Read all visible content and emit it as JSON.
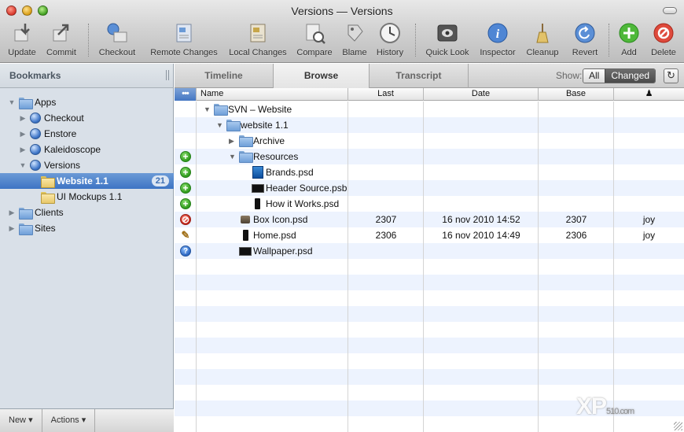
{
  "window": {
    "title": "Versions — Versions"
  },
  "toolbar": {
    "items": [
      {
        "label": "Update",
        "icon": "update-icon"
      },
      {
        "label": "Commit",
        "icon": "commit-icon"
      },
      {
        "label": "Checkout",
        "icon": "checkout-icon"
      },
      {
        "label": "Remote Changes",
        "icon": "remote-changes-icon"
      },
      {
        "label": "Local Changes",
        "icon": "local-changes-icon"
      },
      {
        "label": "Compare",
        "icon": "compare-icon"
      },
      {
        "label": "Blame",
        "icon": "blame-icon"
      },
      {
        "label": "History",
        "icon": "history-icon"
      },
      {
        "label": "Quick Look",
        "icon": "quick-look-icon"
      },
      {
        "label": "Inspector",
        "icon": "inspector-icon"
      },
      {
        "label": "Cleanup",
        "icon": "cleanup-icon"
      },
      {
        "label": "Revert",
        "icon": "revert-icon"
      },
      {
        "label": "Add",
        "icon": "add-icon"
      },
      {
        "label": "Delete",
        "icon": "delete-icon"
      }
    ]
  },
  "sidebar": {
    "title": "Bookmarks",
    "items": [
      {
        "label": "Apps"
      },
      {
        "label": "Checkout"
      },
      {
        "label": "Enstore"
      },
      {
        "label": "Kaleidoscope"
      },
      {
        "label": "Versions"
      },
      {
        "label": "Website 1.1",
        "badge": "21"
      },
      {
        "label": "UI Mockups 1.1"
      },
      {
        "label": "Clients"
      },
      {
        "label": "Sites"
      }
    ],
    "footer": {
      "new_label": "New",
      "actions_label": "Actions"
    }
  },
  "tabs": [
    {
      "label": "Timeline"
    },
    {
      "label": "Browse"
    },
    {
      "label": "Transcript"
    }
  ],
  "filter": {
    "label": "Show:",
    "all": "All",
    "changed": "Changed"
  },
  "table": {
    "columns": {
      "status": "•••",
      "name": "Name",
      "last": "Last",
      "date": "Date",
      "base": "Base",
      "author_icon": "person-icon"
    },
    "rows": [
      {
        "status": "",
        "name": "SVN – Website",
        "last": "",
        "date": "",
        "base": "",
        "author": ""
      },
      {
        "status": "",
        "name": "website 1.1",
        "last": "",
        "date": "",
        "base": "",
        "author": ""
      },
      {
        "status": "",
        "name": "Archive",
        "last": "",
        "date": "",
        "base": "",
        "author": ""
      },
      {
        "status": "added",
        "name": "Resources",
        "last": "",
        "date": "",
        "base": "",
        "author": ""
      },
      {
        "status": "added",
        "name": "Brands.psd",
        "last": "",
        "date": "",
        "base": "",
        "author": ""
      },
      {
        "status": "added",
        "name": "Header Source.psb",
        "last": "",
        "date": "",
        "base": "",
        "author": ""
      },
      {
        "status": "added",
        "name": "How it Works.psd",
        "last": "",
        "date": "",
        "base": "",
        "author": ""
      },
      {
        "status": "deleted",
        "name": "Box Icon.psd",
        "last": "2307",
        "date": "16 nov 2010 14:52",
        "base": "2307",
        "author": "joy"
      },
      {
        "status": "modified",
        "name": "Home.psd",
        "last": "2306",
        "date": "16 nov 2010 14:49",
        "base": "2306",
        "author": "joy"
      },
      {
        "status": "unversioned",
        "name": "Wallpaper.psd",
        "last": "",
        "date": "",
        "base": "",
        "author": ""
      }
    ]
  },
  "watermark": {
    "text": "XP",
    "sub": "510.com"
  }
}
